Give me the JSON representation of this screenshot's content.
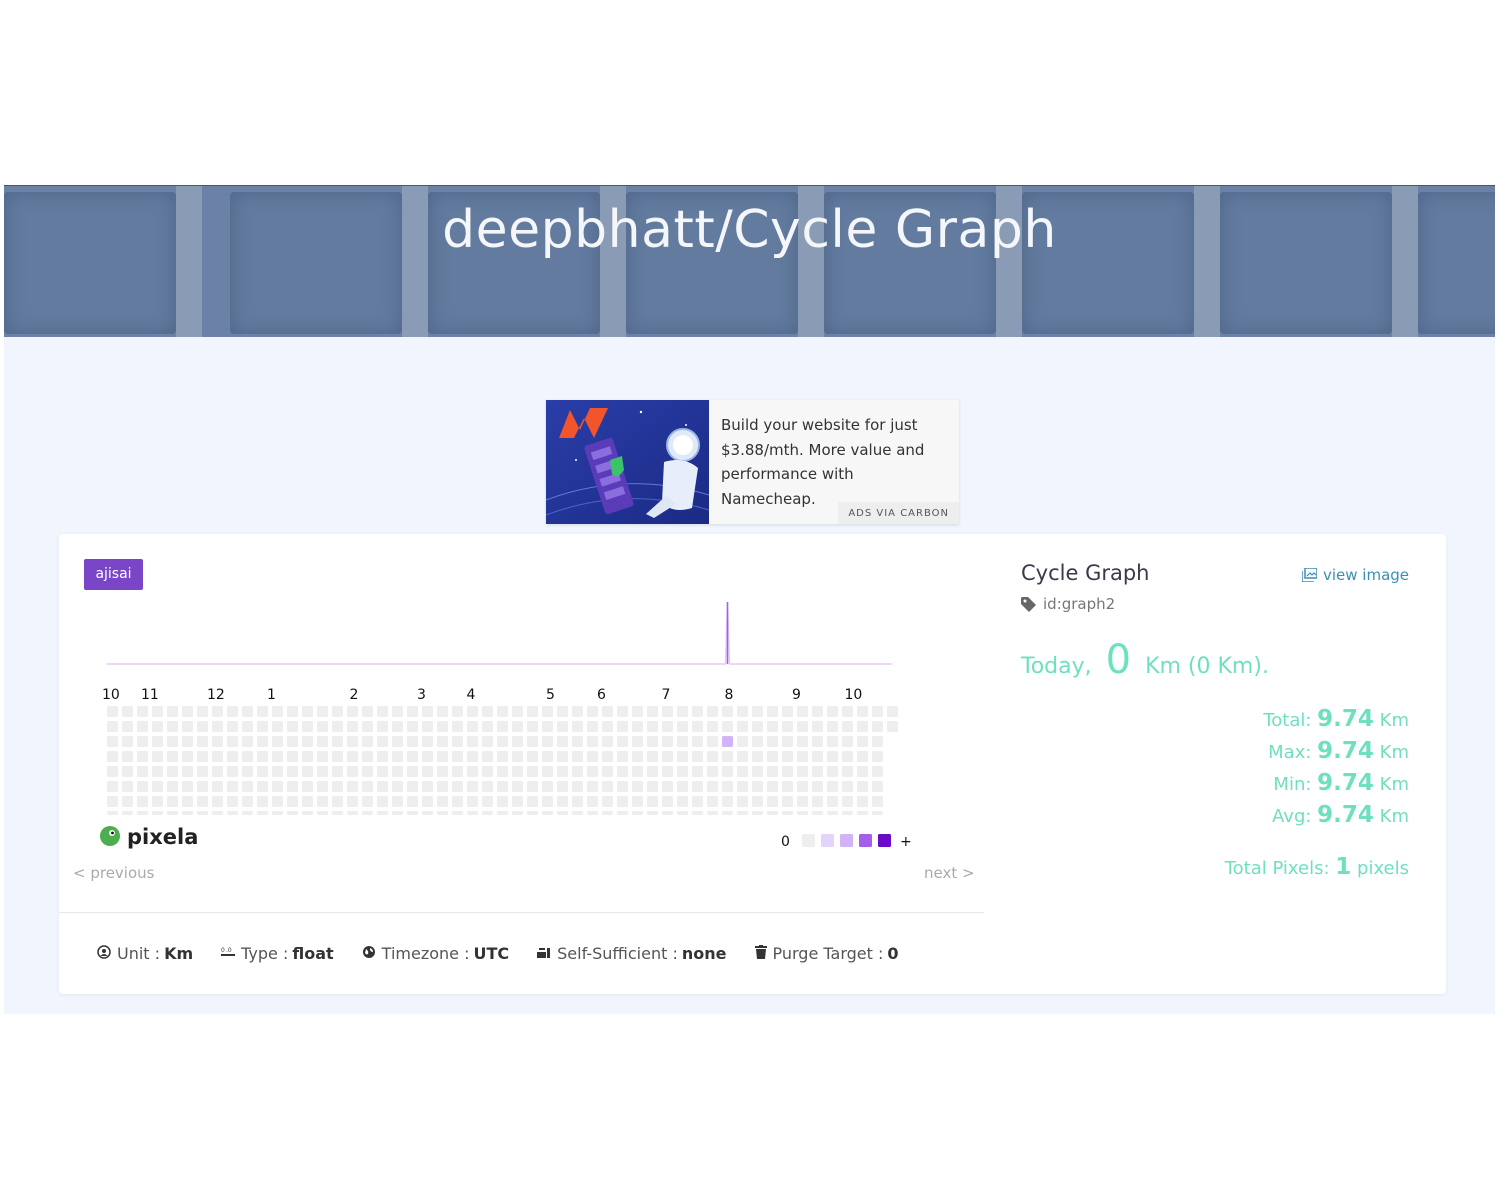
{
  "header": {
    "title": "deepbhatt/Cycle Graph"
  },
  "ad": {
    "text": "Build your website for just $3.88/mth. More value and performance with Namecheap.",
    "via": "ADS VIA CARBON"
  },
  "graph": {
    "theme": "ajisai",
    "months": [
      "10",
      "11",
      "12",
      "1",
      "2",
      "3",
      "4",
      "5",
      "6",
      "7",
      "8",
      "9",
      "10"
    ],
    "legend_min": "0",
    "legend_max": "+",
    "logo_text": "pixela",
    "previous": "< previous",
    "next": "next >",
    "colors": {
      "empty": "#eeeeee",
      "l1": "#e4d4fa",
      "l2": "#d2b3f5",
      "l3": "#a55ee8",
      "l4": "#6b0ac9",
      "line": "#e6c8f7"
    },
    "pixel_date_position": "single pixel during month 8"
  },
  "meta": {
    "unit_label": "Unit",
    "unit_value": "Km",
    "type_label": "Type",
    "type_value": "float",
    "timezone_label": "Timezone",
    "timezone_value": "UTC",
    "self_label": "Self-Sufficient",
    "self_value": "none",
    "purge_label": "Purge Target",
    "purge_value": "0"
  },
  "side": {
    "title": "Cycle Graph",
    "id": "id:graph2",
    "view_image": "view image",
    "today_label": "Today",
    "today_value": "0",
    "today_unit": "Km (0 Km).",
    "total_label": "Total:",
    "total_value": "9.74",
    "unit": "Km",
    "max_label": "Max:",
    "max_value": "9.74",
    "min_label": "Min:",
    "min_value": "9.74",
    "avg_label": "Avg:",
    "avg_value": "9.74",
    "pixels_label": "Total Pixels:",
    "pixels_value": "1",
    "pixels_unit": "pixels"
  }
}
